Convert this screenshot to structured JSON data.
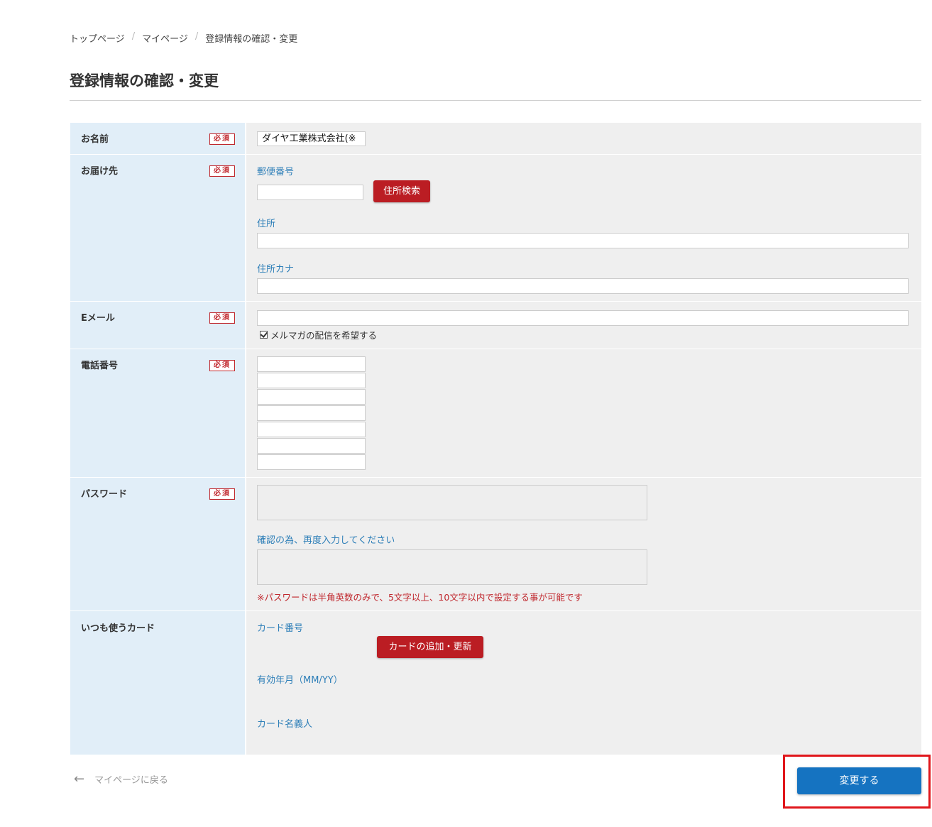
{
  "breadcrumb": [
    "トップページ",
    "マイページ",
    "登録情報の確認・変更"
  ],
  "page_title": "登録情報の確認・変更",
  "required_badge": "必須",
  "rows": {
    "name": {
      "label": "お名前",
      "value": "ダイヤ工業株式会社(※"
    },
    "address": {
      "label": "お届け先",
      "postal_label": "郵便番号",
      "search_button": "住所検索",
      "address_label": "住所",
      "kana_label": "住所カナ"
    },
    "email": {
      "label": "Eメール",
      "newsletter_label": "メルマガの配信を希望する",
      "newsletter_checked": true
    },
    "phone": {
      "label": "電話番号"
    },
    "password": {
      "label": "パスワード",
      "confirm_label": "確認の為、再度入力してください",
      "note": "※パスワードは半角英数のみで、5文字以上、10文字以内で設定する事が可能です"
    },
    "card": {
      "label": "いつも使うカード",
      "number_label": "カード番号",
      "update_button": "カードの追加・更新",
      "expiry_label": "有効年月（MM/YY）",
      "holder_label": "カード名義人"
    }
  },
  "back_link": "マイページに戻る",
  "submit_button": "変更する",
  "colors": {
    "accent_red": "#bb1d23",
    "primary_blue": "#1573c1",
    "label_bg": "#e1eef8",
    "highlight": "#e0161b"
  }
}
